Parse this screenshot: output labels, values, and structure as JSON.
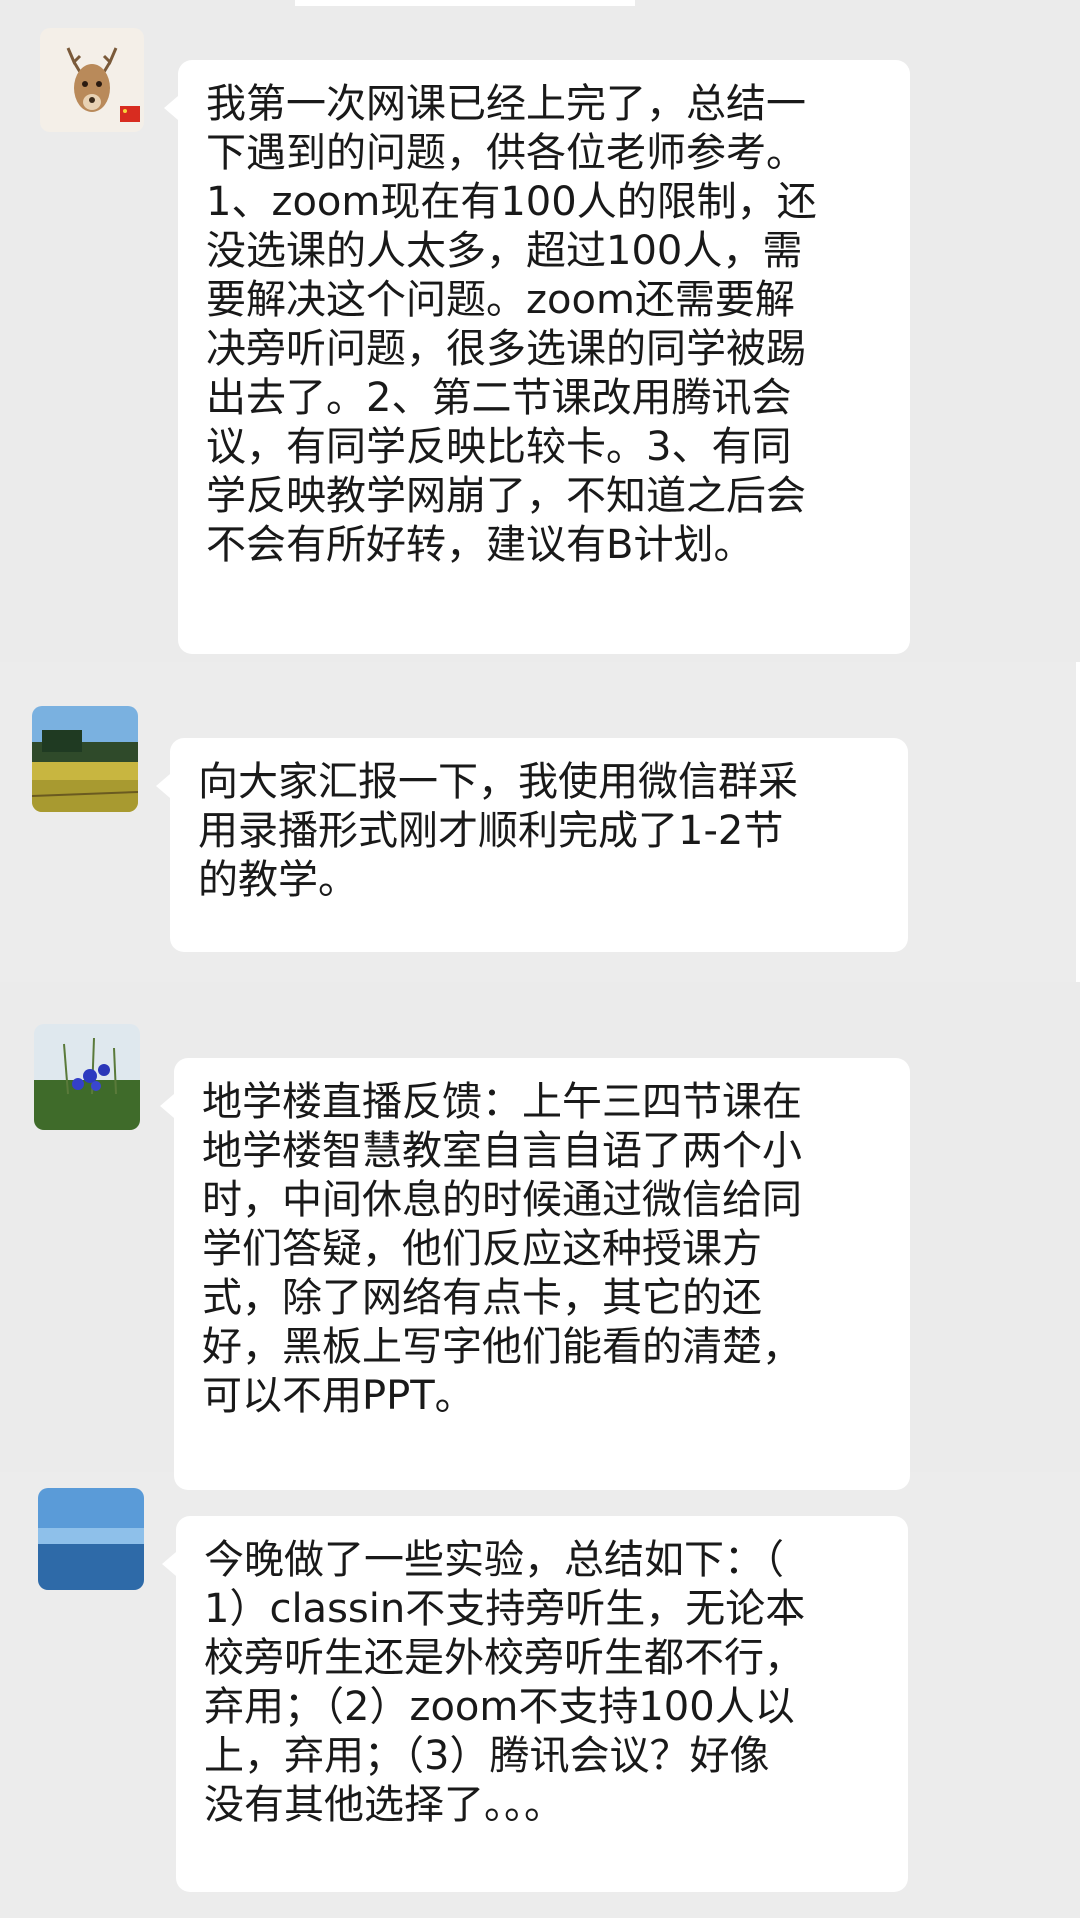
{
  "colors": {
    "background": "#ededed",
    "bubble": "#ffffff",
    "text": "#191919"
  },
  "messages": [
    {
      "avatar": "deer-avatar",
      "lines": "我第一次网课已经上完了，总结一\n下遇到的问题，供各位老师参考。\n1、zoom现在有100人的限制，还\n没选课的人太多，超过100人，需\n要解决这个问题。zoom还需要解\n决旁听问题，很多选课的同学被踢\n出去了。2、第二节课改用腾讯会\n议，有同学反映比较卡。3、有同\n学反映教学网崩了，不知道之后会\n不会有所好转，建议有B计划。"
    },
    {
      "avatar": "landscape-avatar",
      "lines": "向大家汇报一下，我使用微信群采\n用录播形式刚才顺利完成了1-2节\n的教学。"
    },
    {
      "avatar": "flowers-avatar",
      "lines": "地学楼直播反馈：上午三四节课在\n地学楼智慧教室自言自语了两个小\n时，中间休息的时候通过微信给同\n学们答疑，他们反应这种授课方\n式，除了网络有点卡，其它的还\n好，黑板上写字他们能看的清楚，\n可以不用PPT。"
    },
    {
      "avatar": "sea-sky-avatar",
      "lines": "今晚做了一些实验，总结如下：（\n1）classin不支持旁听生，无论本\n校旁听生还是外校旁听生都不行，\n弃用；（2）zoom不支持100人以\n上，弃用；（3）腾讯会议？好像\n没有其他选择了。。。"
    }
  ]
}
